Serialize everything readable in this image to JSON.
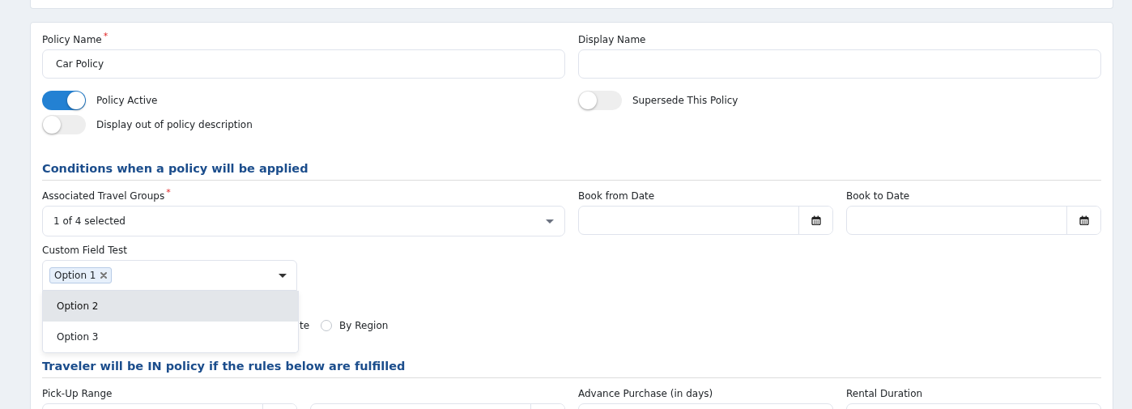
{
  "fields_top": [
    {
      "label": "Policy Name",
      "required_mark": "*",
      "value": "Car Policy"
    },
    {
      "label": "Display Name"
    }
  ],
  "toggles_left": [
    {
      "label": "Policy Active",
      "on": true
    },
    {
      "label": "Display out of policy description",
      "on": false
    }
  ],
  "toggles_right": [
    {
      "label": "Supersede This Policy",
      "on": false
    }
  ],
  "conditions": {
    "heading": "Conditions when a policy will be applied",
    "travel_groups": {
      "label": "Associated Travel Groups",
      "required_mark": "*",
      "value": "1 of 4 selected"
    },
    "book_from": {
      "label": "Book from Date"
    },
    "book_to": {
      "label": "Book to Date"
    },
    "custom_field": {
      "label": "Custom Field Test",
      "tags": [
        {
          "label": "Option 1"
        }
      ],
      "menu": [
        {
          "label": "Option 2",
          "highlighted": true
        },
        {
          "label": "Option 3",
          "highlighted": false
        }
      ]
    },
    "radio_partial_label": "te",
    "radios": [
      {
        "label": "By Region",
        "selected": false
      }
    ]
  },
  "rules": {
    "heading": "Traveler will be IN policy if the rules below are fulfilled",
    "pickup_range": {
      "label": "Pick-Up Range"
    },
    "advance_purchase": {
      "label": "Advance Purchase (in days)"
    },
    "rental_duration": {
      "label": "Rental Duration"
    }
  }
}
